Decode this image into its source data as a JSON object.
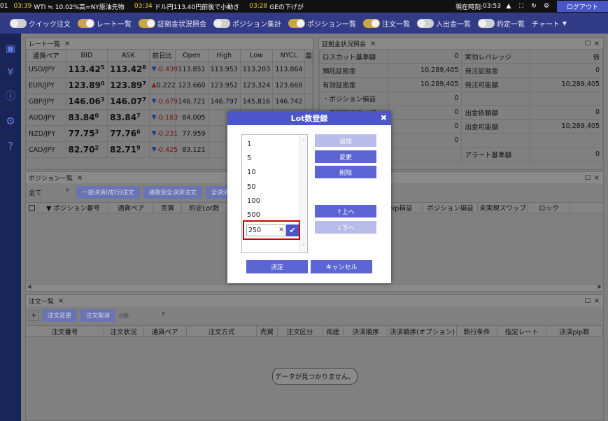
{
  "ticker": {
    "clip": "01",
    "items": [
      {
        "time": "03:39",
        "text": "WTI ≒ 10.02%高=NY原油先物"
      },
      {
        "time": "03:34",
        "text": "ドル円113.40円前後で小動き"
      },
      {
        "time": "03:28",
        "text": "GEの下げが"
      }
    ],
    "clock_label": "現在時刻:",
    "clock_value": "03:53",
    "logout": "ログアウト"
  },
  "nav": {
    "items": [
      {
        "label": "クイック注文",
        "on": false
      },
      {
        "label": "レート一覧",
        "on": true
      },
      {
        "label": "証拠金状況照会",
        "on": true
      },
      {
        "label": "ポジション集計",
        "on": false
      },
      {
        "label": "ポジション一覧",
        "on": true
      },
      {
        "label": "注文一覧",
        "on": true
      },
      {
        "label": "入出金一覧",
        "on": false
      },
      {
        "label": "約定一覧",
        "on": false
      }
    ],
    "chart_label": "チャート"
  },
  "rate_panel": {
    "title": "レート一覧",
    "headers": [
      "通貨ペア",
      "BID",
      "ASK",
      "前日比",
      "Open",
      "High",
      "Low",
      "NYCL",
      "最"
    ],
    "rows": [
      {
        "pair": "USD/JPY",
        "bid_main": "113.42",
        "bid_pip": "5",
        "ask_main": "113.42",
        "ask_pip": "8",
        "dir": "down",
        "chg": "-0.439",
        "open": "113.851",
        "high": "113.953",
        "low": "113.203",
        "nycl": "113.864"
      },
      {
        "pair": "EUR/JPY",
        "bid_main": "123.89",
        "bid_pip": "0",
        "ask_main": "123.89",
        "ask_pip": "7",
        "dir": "up",
        "chg": "0.222",
        "open": "123.660",
        "high": "123.952",
        "low": "123.324",
        "nycl": "123.668"
      },
      {
        "pair": "GBP/JPY",
        "bid_main": "146.06",
        "bid_pip": "3",
        "ask_main": "146.07",
        "ask_pip": "7",
        "dir": "down",
        "chg": "-0.679",
        "open": "146.721",
        "high": "146.797",
        "low": "145.816",
        "nycl": "146.742"
      },
      {
        "pair": "AUD/JPY",
        "bid_main": "83.84",
        "bid_pip": "0",
        "ask_main": "83.84",
        "ask_pip": "7",
        "dir": "down",
        "chg": "-0.183",
        "open": "84.005",
        "high": "84",
        "low": "",
        "nycl": ""
      },
      {
        "pair": "NZD/JPY",
        "bid_main": "77.75",
        "bid_pip": "3",
        "ask_main": "77.76",
        "ask_pip": "6",
        "dir": "down",
        "chg": "-0.231",
        "open": "77.959",
        "high": "77.",
        "low": "",
        "nycl": ""
      },
      {
        "pair": "CAD/JPY",
        "bid_main": "82.70",
        "bid_pip": "2",
        "ask_main": "82.71",
        "ask_pip": "9",
        "dir": "down",
        "chg": "-0.425",
        "open": "83.121",
        "high": "83.",
        "low": "",
        "nycl": ""
      }
    ]
  },
  "margin_panel": {
    "title": "証拠金状況照会",
    "rows": [
      {
        "l1": "ロスカット基準額",
        "v1": "0",
        "l2": "実効レバレッジ",
        "v2": "倍"
      },
      {
        "l1": "預託証拠金",
        "v1": "10,289,405",
        "l2": "発注証拠金",
        "v2": "0"
      },
      {
        "l1": "有効証拠金",
        "v1": "10,289,405",
        "l2": "発注可能額",
        "v2": "10,289,405"
      },
      {
        "l1": "・ポジション損益",
        "v1": "0",
        "l2": "",
        "v2": ""
      },
      {
        "l1": "・未実現スワップ",
        "v1": "0",
        "l2": "出金依頼額",
        "v2": "0"
      },
      {
        "l1": "",
        "v1": "0",
        "l2": "出金可能額",
        "v2": "10,289,405"
      },
      {
        "l1": "",
        "v1": "0",
        "l2": "",
        "v2": ""
      },
      {
        "l1": "",
        "v1": "",
        "l2": "アラート基準額",
        "v2": "0"
      }
    ]
  },
  "position_panel": {
    "title": "ポジション一覧",
    "filter": "全て",
    "buttons": [
      "一括決済(成行)注文",
      "通貨別全決済注文",
      "全決済"
    ],
    "headers": [
      "▼ ポジション番号",
      "通貨ペア",
      "売買",
      "約定Lot数",
      "pip損益",
      "ポジション損益",
      "未実現スワップ",
      "ロック"
    ]
  },
  "order_panel": {
    "title": "注文一覧",
    "add": "+",
    "modify": "注文変更",
    "cancel": "注文取消",
    "count": "0件",
    "headers": [
      "注文番号",
      "注文状況",
      "通貨ペア",
      "注文方式",
      "売買",
      "注文区分",
      "両建",
      "決済順序",
      "決済順序(オプション)",
      "執行条件",
      "指定レート",
      "決済pip数"
    ],
    "empty": "データが見つかりません。"
  },
  "dialog": {
    "title": "Lot数登録",
    "items": [
      "1",
      "5",
      "10",
      "50",
      "100",
      "500"
    ],
    "edit_value": "250",
    "add": "追加",
    "change": "変更",
    "delete": "削除",
    "up": "↑上へ",
    "down": "↓下へ",
    "ok": "決定",
    "cancel": "キャンセル"
  }
}
